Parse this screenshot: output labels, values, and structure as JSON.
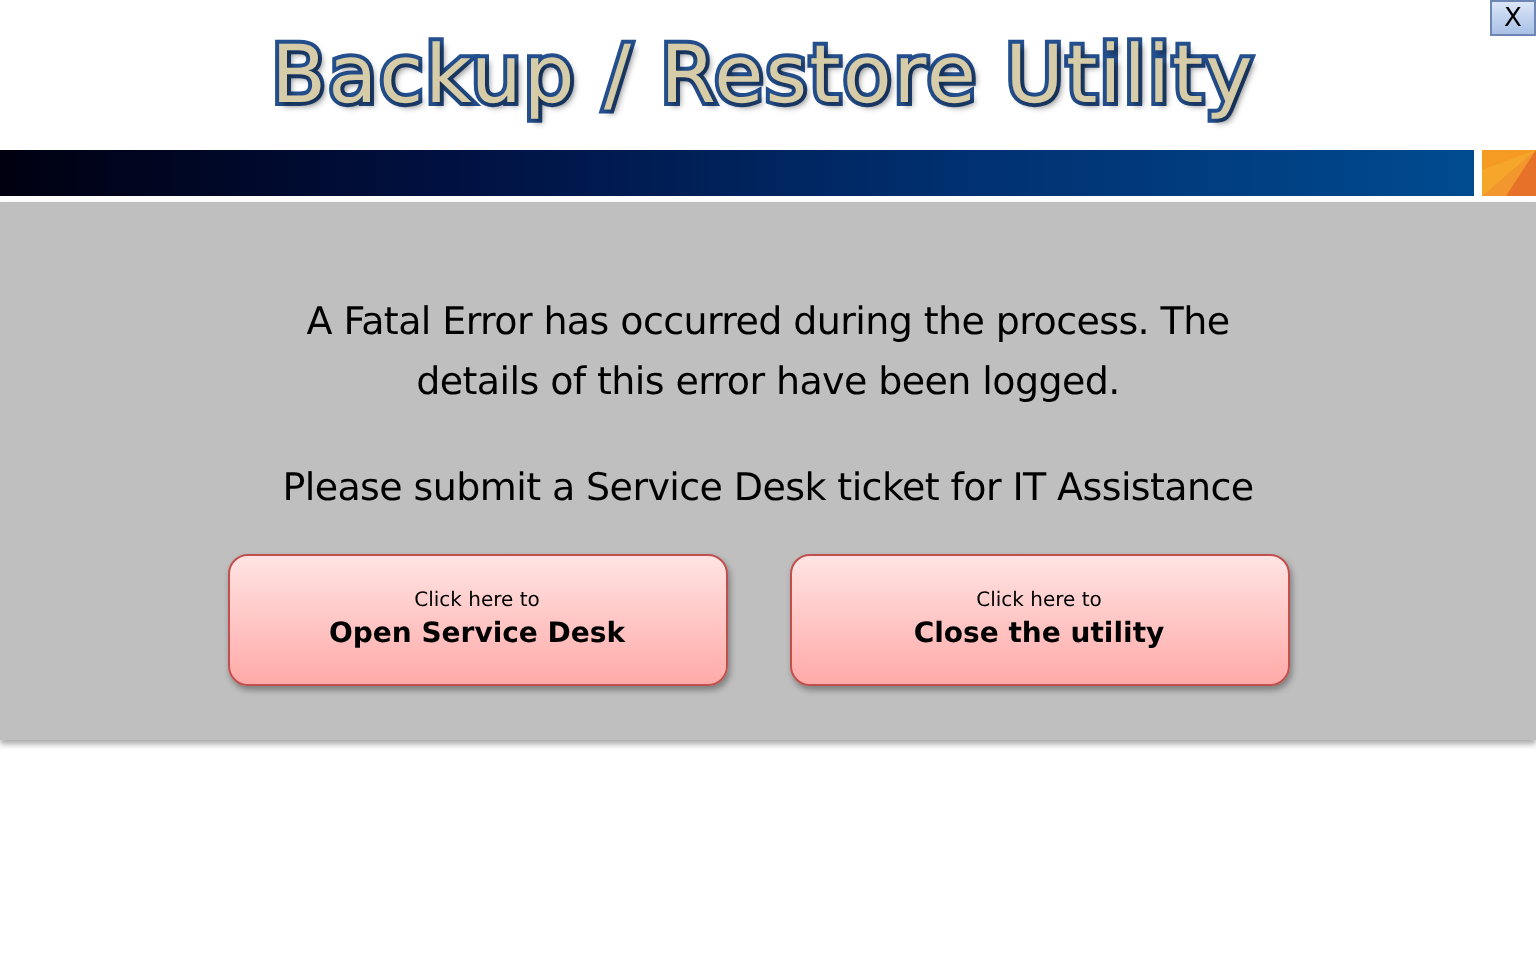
{
  "close_button": "X",
  "title": "Backup / Restore Utility",
  "message": [
    "A Fatal Error has occurred during the process. The details of this error have been logged.",
    "Please submit a Service Desk ticket for IT Assistance"
  ],
  "buttons": [
    {
      "hint": "Click here to",
      "label": "Open Service Desk"
    },
    {
      "hint": "Click here to",
      "label": "Close the utility"
    }
  ]
}
